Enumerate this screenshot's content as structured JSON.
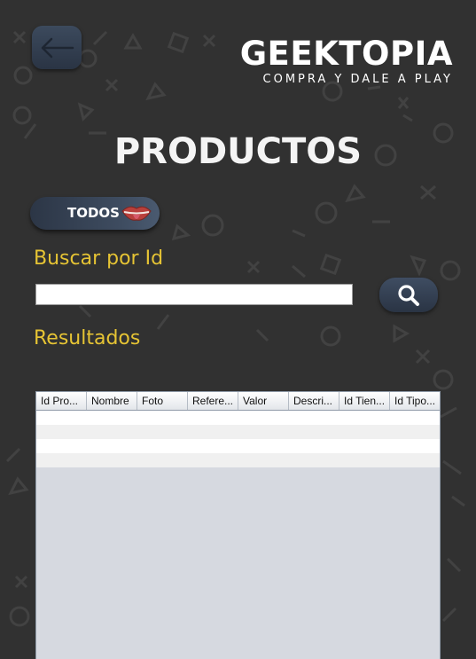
{
  "header": {
    "brand_name": "GEEKTOPIA",
    "brand_tagline": "COMPRA Y DALE A PLAY"
  },
  "page": {
    "title": "PRODUCTOS"
  },
  "buttons": {
    "todos_label": "TODOS"
  },
  "search": {
    "label": "Buscar por Id",
    "value": "",
    "placeholder": ""
  },
  "results": {
    "label": "Resultados",
    "columns": [
      "Id Pro...",
      "Nombre",
      "Foto",
      "Refere...",
      "Valor",
      "Descri...",
      "Id Tien...",
      "Id Tipo..."
    ],
    "rows": []
  },
  "colors": {
    "background": "#313131",
    "accent_text": "#e6c434",
    "button": "#34404f"
  },
  "icons": {
    "back": "arrow-left-icon",
    "search": "search-icon",
    "todos": "lips-icon"
  }
}
